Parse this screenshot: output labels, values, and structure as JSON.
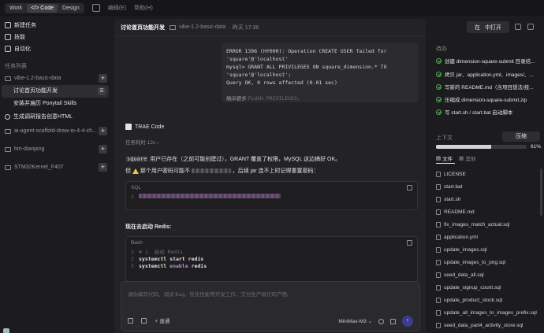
{
  "topbar": {
    "modes": [
      "Work",
      "Code",
      "Design"
    ],
    "active_mode": "Code",
    "menus": [
      "编辑(E)",
      "帮助(H)"
    ]
  },
  "sidebar": {
    "actions": [
      {
        "label": "新建任务",
        "icon": "new-task-icon"
      },
      {
        "label": "技能",
        "icon": "skills-icon"
      },
      {
        "label": "自动化",
        "icon": "automation-icon"
      }
    ],
    "section_label": "任务列表",
    "projects": [
      {
        "name": "vibe-1.2-basic-data",
        "tasks": [
          {
            "label": "讨论首页功能开发",
            "selected": true
          },
          {
            "label": "安装并遍历 Ponytail Skills",
            "selected": false
          }
        ]
      }
    ],
    "standalone_task": "生成调研报告创意HTML",
    "other_projects": [
      "ai-agent-scaffold-draw-io-4-4-ch...",
      "hm-dianping",
      "STM32Kernel_F407"
    ]
  },
  "chat": {
    "title": "讨论首页功能开发",
    "folder": "vibe-1.2-basic-data",
    "meta": "· 昨天 17:36",
    "terminal_lines": [
      "ERROR 1396 (HY000): Operation CREATE USER failed for 'square'@'localhost'",
      "mysql> GRANT ALL PRIVILEGES ON square_dimension.* TO 'square'@'localhost';",
      "Query OK, 0 rows affected (0.01 sec)",
      "",
      "mysql> FLUSH PRIVILEGES;"
    ],
    "show_more": "展示更多",
    "agent_name": "TRAE Code",
    "task_time_label": "任务耗时 12s",
    "para1_code": "square",
    "para1_text": " 用户已存在（之前可能创建过），GRANT 覆盖了权限，MySQL 这边搞好 OK。",
    "para2_pre": " 那个用户密码可能不",
    "para2_post": "，后续 jar 连不上时记得重置密码：",
    "para2_lead": "但",
    "code1_lang": "SQL",
    "code1_line_no": "1",
    "para3": "现在去启动 Redis:",
    "code2_lang": "Bash",
    "code2_lines": [
      {
        "no": "1",
        "text": "# 1. 启动 Redis",
        "kind": "comment"
      },
      {
        "no": "2",
        "a": "systemctl",
        "b": "start",
        "c": "redis",
        "kind": "cmd"
      },
      {
        "no": "3",
        "a": "systemctl",
        "b": "enable",
        "c": "redis",
        "kind": "cmd"
      }
    ],
    "input_placeholder": "请你编写代码、调试 Bug、优化性能等开发工作，交付生产级代码产物。",
    "input_tool": "速通",
    "model": "MiniMax-M3",
    "send_icon": "send-icon"
  },
  "right": {
    "open_label": "中打开",
    "open_prefix": "在",
    "todo_label": "待办",
    "todos": [
      "创建 dimension-square-submit 目录结...",
      "拷贝 jar、application.yml、images/、...",
      "写新的 README.md（含项目想法/技...",
      "压缩成 dimension-square-submit.zip",
      "写 start.sh / start.bat 启动脚本"
    ],
    "context_label": "上下文",
    "compress_label": "压缩",
    "progress_pct": "61%",
    "progress_value": 61,
    "tabs": [
      "文件",
      "其他"
    ],
    "files": [
      "LICENSE",
      "start.bat",
      "start.sh",
      "README.md",
      "fix_images_match_actual.sql",
      "application.yml",
      "update_images.sql",
      "update_images_to_png.sql",
      "seed_data_all.sql",
      "update_signup_count.sql",
      "update_product_stock.sql",
      "update_all_images_to_images_prefix.sql",
      "seed_data_part4_activity_store.sql"
    ]
  }
}
